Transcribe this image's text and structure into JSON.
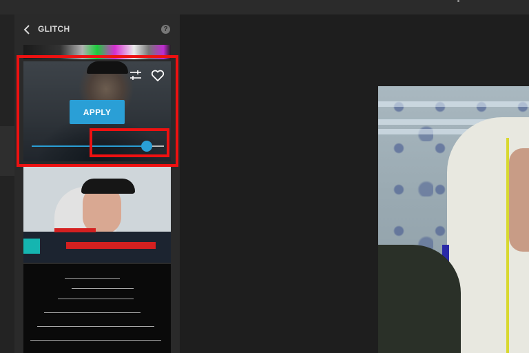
{
  "panel": {
    "title": "GLITCH",
    "help_label": "?",
    "apply_label": "APPLY"
  },
  "slider": {
    "value_fraction": 0.87
  },
  "colors": {
    "accent": "#2a9fd6",
    "highlight": "#ee1111",
    "panel_bg": "#2a2a2a",
    "canvas_bg": "#1e1e1e"
  },
  "icons": {
    "back": "chevron-left-icon",
    "help": "question-circle-icon",
    "adjust": "sliders-icon",
    "favorite": "heart-icon"
  }
}
